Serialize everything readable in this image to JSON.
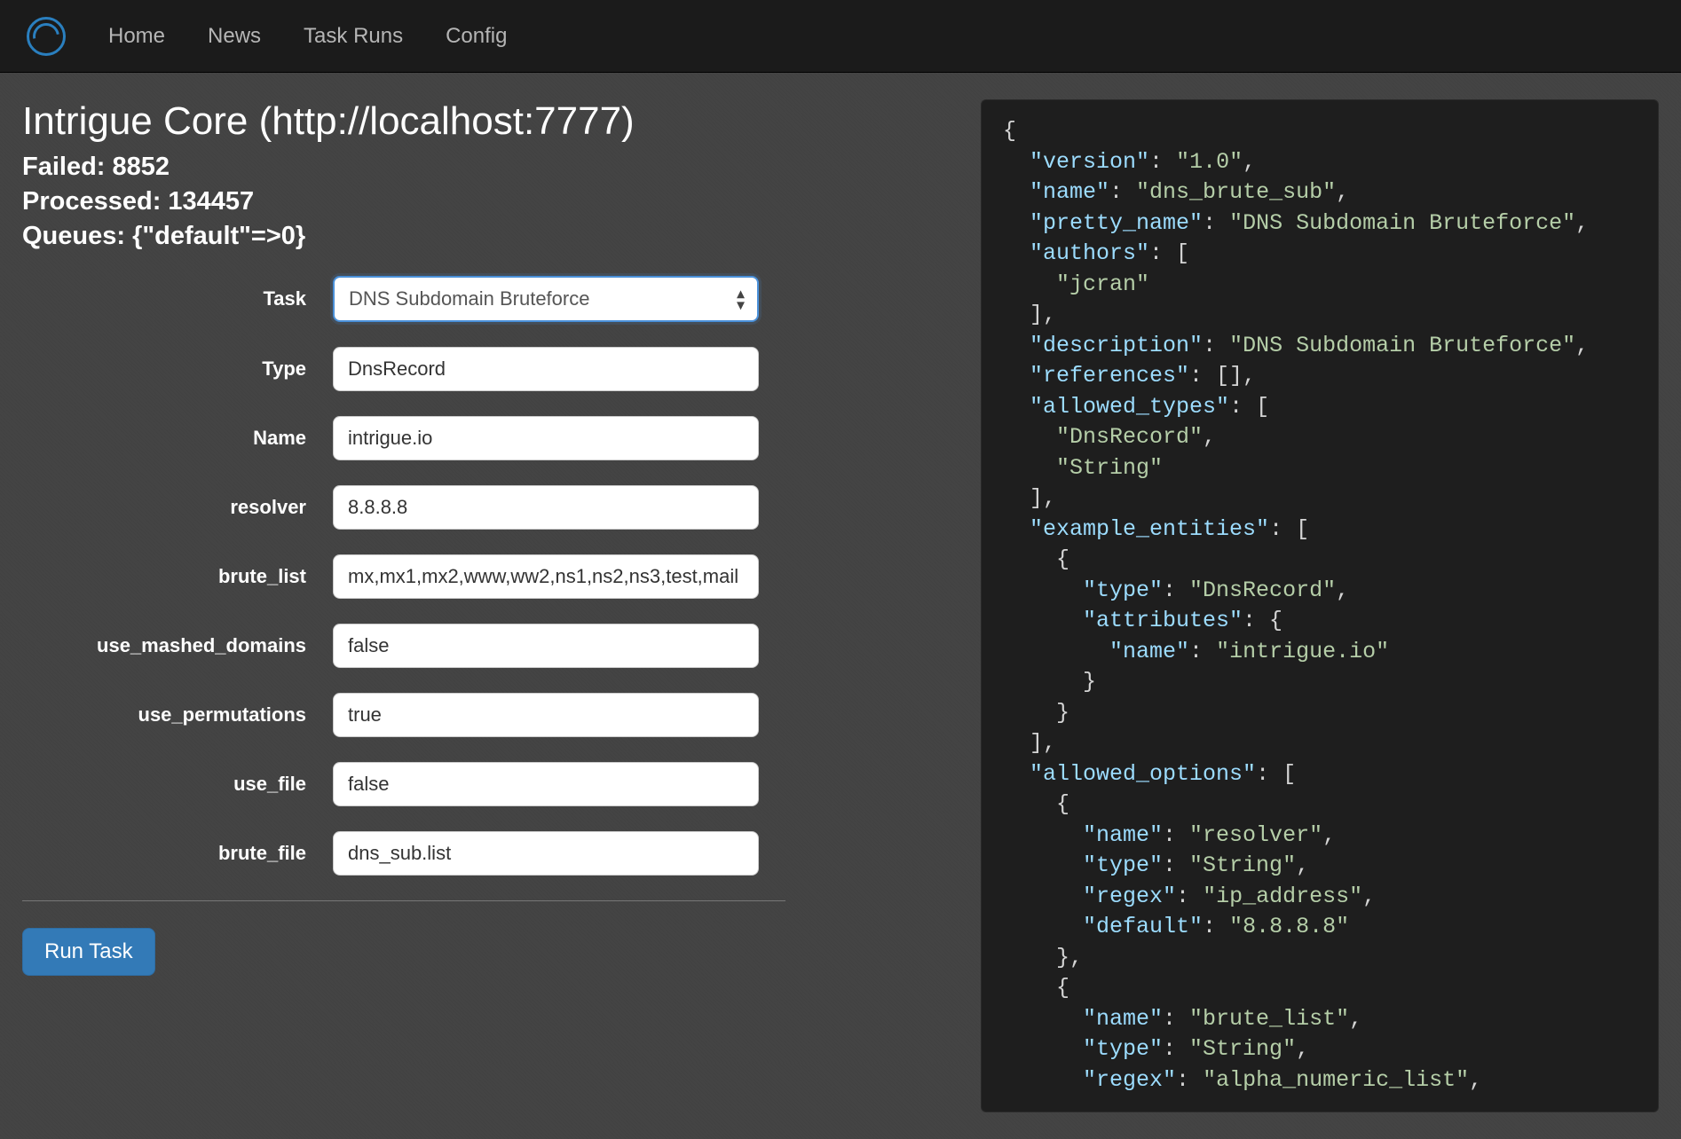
{
  "nav": {
    "home": "Home",
    "news": "News",
    "taskruns": "Task Runs",
    "config": "Config"
  },
  "header": {
    "title": "Intrigue Core (http://localhost:7777)",
    "failed_label": "Failed: 8852",
    "processed_label": "Processed: 134457",
    "queues_label": "Queues: {\"default\"=>0}"
  },
  "form": {
    "task_label": "Task",
    "task_value": "DNS Subdomain Bruteforce",
    "type_label": "Type",
    "type_value": "DnsRecord",
    "name_label": "Name",
    "name_value": "intrigue.io",
    "resolver_label": "resolver",
    "resolver_value": "8.8.8.8",
    "brute_list_label": "brute_list",
    "brute_list_value": "mx,mx1,mx2,www,ww2,ns1,ns2,ns3,test,mail",
    "use_mashed_domains_label": "use_mashed_domains",
    "use_mashed_domains_value": "false",
    "use_permutations_label": "use_permutations",
    "use_permutations_value": "true",
    "use_file_label": "use_file",
    "use_file_value": "false",
    "brute_file_label": "brute_file",
    "brute_file_value": "dns_sub.list",
    "run_button": "Run Task"
  },
  "json_panel": {
    "version": "1.0",
    "name": "dns_brute_sub",
    "pretty_name": "DNS Subdomain Bruteforce",
    "authors": [
      "jcran"
    ],
    "description": "DNS Subdomain Bruteforce",
    "references": [],
    "allowed_types": [
      "DnsRecord",
      "String"
    ],
    "example_entities": [
      {
        "type": "DnsRecord",
        "attributes": {
          "name": "intrigue.io"
        }
      }
    ],
    "allowed_options": [
      {
        "name": "resolver",
        "type": "String",
        "regex": "ip_address",
        "default": "8.8.8.8"
      },
      {
        "name": "brute_list",
        "type": "String",
        "regex": "alpha_numeric_list"
      }
    ]
  }
}
